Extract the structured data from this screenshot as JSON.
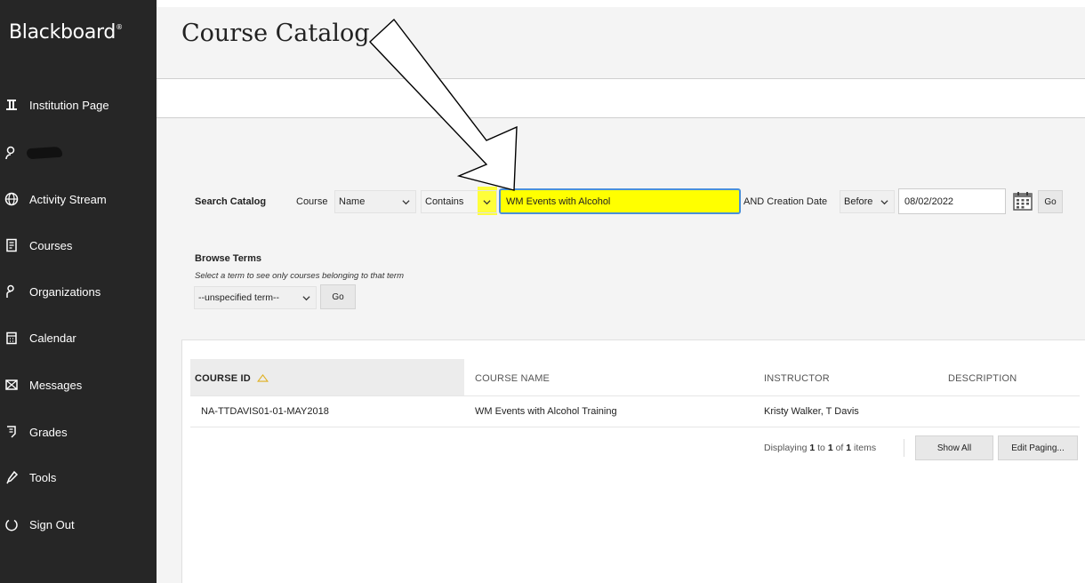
{
  "app": {
    "brand": "Blackboard",
    "brand_mark": "®"
  },
  "sidebar": {
    "items": [
      {
        "label": "Institution Page",
        "icon": "institution-icon"
      },
      {
        "label": "",
        "icon": "user-icon"
      },
      {
        "label": "Activity Stream",
        "icon": "globe-icon"
      },
      {
        "label": "Courses",
        "icon": "courses-icon"
      },
      {
        "label": "Organizations",
        "icon": "organizations-icon"
      },
      {
        "label": "Calendar",
        "icon": "calendar-icon"
      },
      {
        "label": "Messages",
        "icon": "messages-icon"
      },
      {
        "label": "Grades",
        "icon": "grades-icon"
      },
      {
        "label": "Tools",
        "icon": "tools-icon"
      },
      {
        "label": "Sign Out",
        "icon": "power-icon"
      }
    ]
  },
  "header": {
    "title": "Course Catalog"
  },
  "search": {
    "label": "Search Catalog",
    "field_label": "Course",
    "field_select": "Name",
    "operator_select": "Contains",
    "query": "WM Events with Alcohol",
    "date_label": "AND Creation Date",
    "date_operator": "Before",
    "date_value": "08/02/2022",
    "go_label": "Go"
  },
  "browse": {
    "title": "Browse Terms",
    "note": "Select a term to see only courses belonging to that term",
    "term_select": "--unspecified term--",
    "go_label": "Go"
  },
  "table": {
    "headers": [
      "COURSE ID",
      "COURSE NAME",
      "INSTRUCTOR",
      "DESCRIPTION"
    ],
    "rows": [
      {
        "course_id": "NA-TTDAVIS01-01-MAY2018",
        "course_name": "WM Events with Alcohol Training",
        "instructor": "Kristy Walker, T Davis",
        "description": ""
      }
    ],
    "paging": {
      "prefix": "Displaying",
      "from": "1",
      "to_word": "to",
      "to": "1",
      "of_word": "of",
      "total": "1",
      "suffix": "items"
    },
    "show_all_label": "Show All",
    "edit_paging_label": "Edit Paging..."
  },
  "colors": {
    "sidebar_bg": "#262626",
    "highlight": "#ffff00",
    "focus_border": "#4a90d9"
  }
}
